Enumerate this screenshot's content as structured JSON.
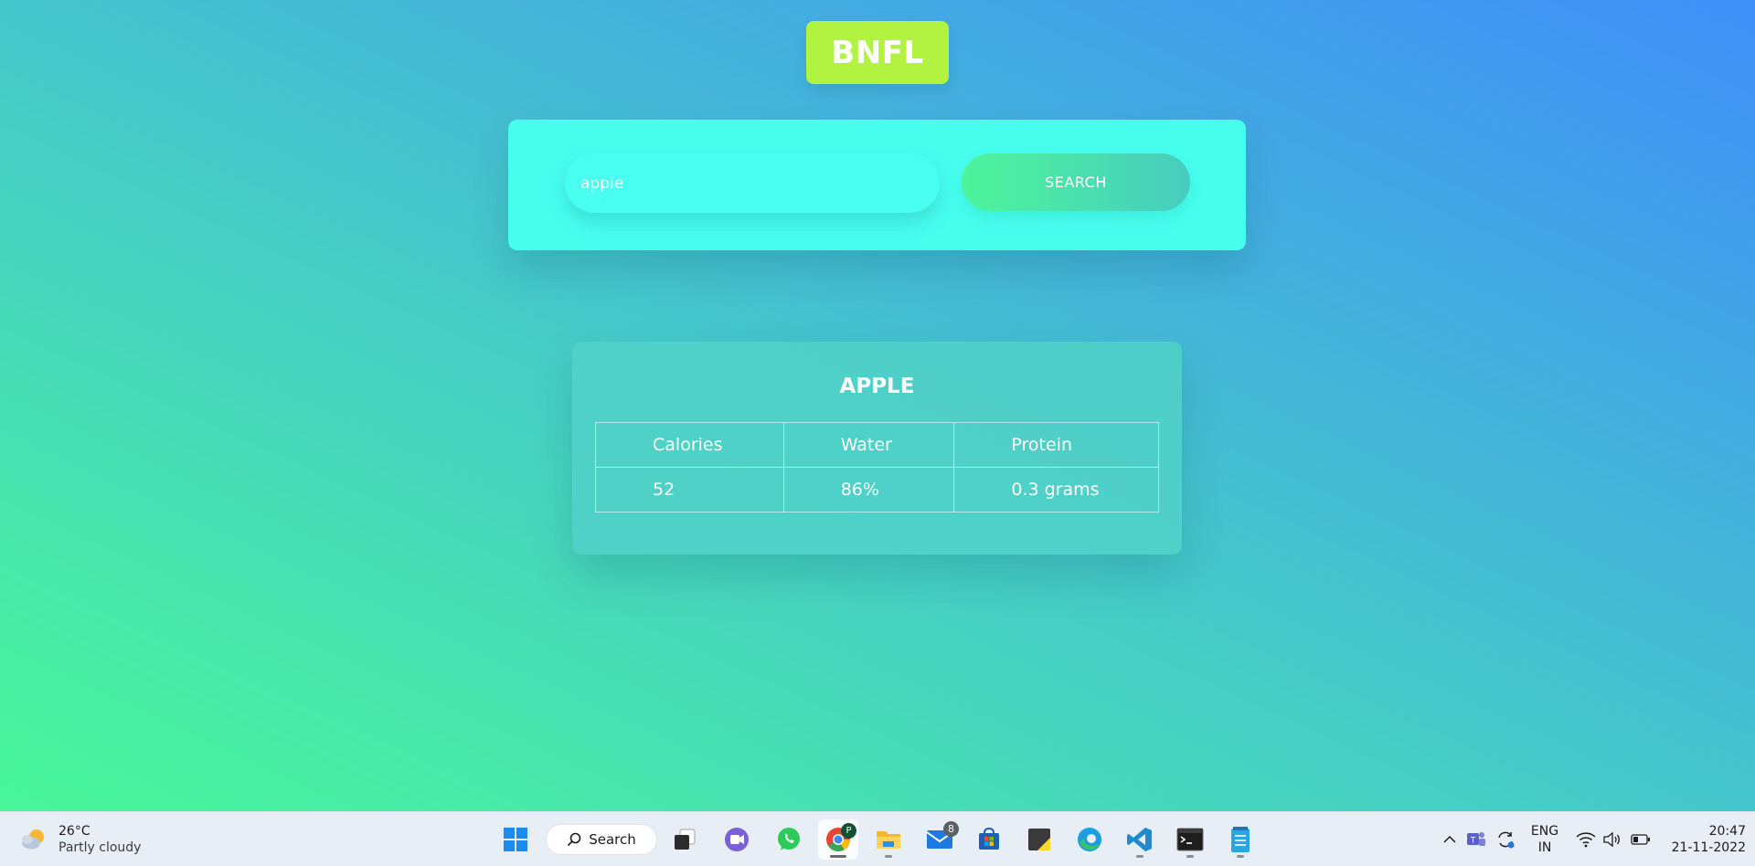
{
  "app": {
    "brand": "BNFL"
  },
  "search": {
    "query": "appie",
    "button_label": "SEARCH"
  },
  "result": {
    "title": "APPLE",
    "columns": [
      "Calories",
      "Water",
      "Protein"
    ],
    "values": [
      "52",
      "86%",
      "0.3 grams"
    ]
  },
  "taskbar": {
    "weather": {
      "temp": "26°C",
      "desc": "Partly cloudy",
      "icon": "partly-cloudy-icon"
    },
    "search_label": "Search",
    "apps": [
      {
        "name": "start",
        "icon": "windows-start-icon"
      },
      {
        "name": "task-view",
        "icon": "task-view-icon"
      },
      {
        "name": "teams-meet",
        "icon": "video-call-icon"
      },
      {
        "name": "whatsapp",
        "icon": "whatsapp-icon"
      },
      {
        "name": "chrome",
        "icon": "chrome-icon",
        "profile": "P"
      },
      {
        "name": "file-explorer",
        "icon": "folder-icon"
      },
      {
        "name": "mail",
        "icon": "mail-icon",
        "badge": "8"
      },
      {
        "name": "store",
        "icon": "store-icon"
      },
      {
        "name": "sticky-notes",
        "icon": "sticky-notes-icon"
      },
      {
        "name": "edge",
        "icon": "edge-icon"
      },
      {
        "name": "vscode",
        "icon": "vscode-icon"
      },
      {
        "name": "terminal",
        "icon": "terminal-icon"
      },
      {
        "name": "notepad",
        "icon": "notepad-icon"
      }
    ],
    "language": [
      "ENG",
      "IN"
    ],
    "time": "20:47",
    "date": "21-11-2022"
  },
  "colors": {
    "brand_bg": "#b2f240",
    "search_panel": "#47feed",
    "button_gradient_start": "#4df59a",
    "button_gradient_end": "#47ccc0",
    "bg_bottom_left": "#49f79a",
    "bg_top_right": "#3f8ff8"
  }
}
